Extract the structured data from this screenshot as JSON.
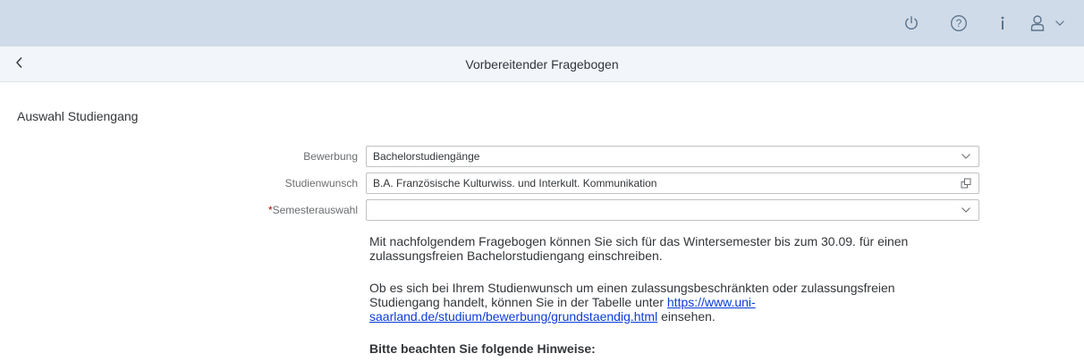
{
  "shell": {
    "icons": [
      "power-icon",
      "help-icon",
      "info-icon",
      "user-icon",
      "chevron-down-icon"
    ],
    "colors": {
      "bar": "#d0dbe9",
      "icon": "#5b738b"
    }
  },
  "page": {
    "title": "Vorbereitender Fragebogen"
  },
  "section": {
    "title": "Auswahl Studiengang"
  },
  "form": {
    "bewerbung": {
      "label": "Bewerbung",
      "value": "Bachelorstudiengänge"
    },
    "studienwunsch": {
      "label": "Studienwunsch",
      "value": "B.A. Französische Kulturwiss. und Interkult. Kommunikation"
    },
    "semester": {
      "required_mark": "*",
      "label": "Semesterauswahl",
      "value": ""
    }
  },
  "info": {
    "p1_line1": "Mit nachfolgendem Fragebogen können Sie sich für das Wintersemester bis zum 30.09. für einen",
    "p1_line2": "zulassungsfreien Bachelorstudiengang einschreiben.",
    "p2_line1": "Ob es sich bei Ihrem Studienwunsch um einen zulassungsbeschränkten oder zulassungsfreien",
    "p2_line2_pre": "Studiengang handelt, können Sie in der Tabelle unter ",
    "link_part1": "https://www.uni-",
    "link_part2": "saarland.de/studium/bewerbung/grundstaendig.html",
    "p2_line3_post": " einsehen.",
    "hint_heading": "Bitte beachten Sie folgende Hinweise:"
  }
}
